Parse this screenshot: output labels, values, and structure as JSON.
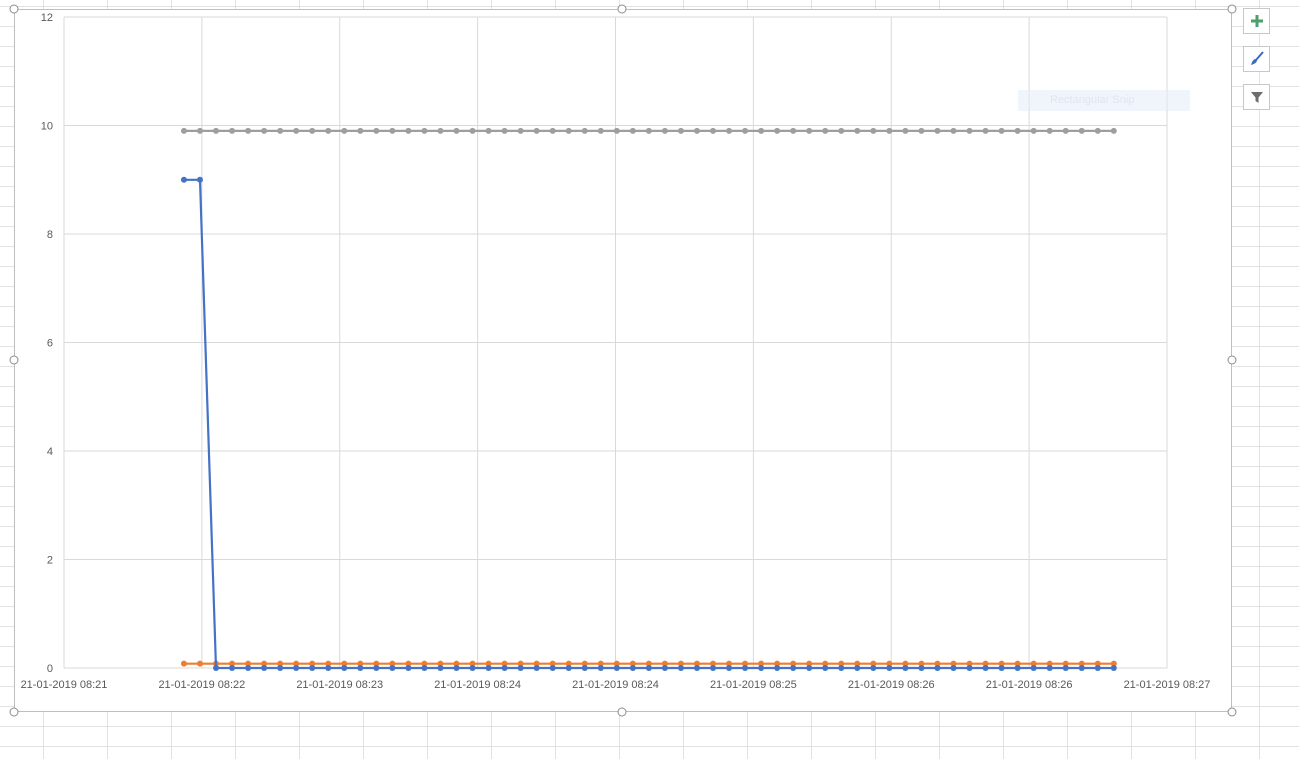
{
  "chart_data": {
    "type": "line",
    "title": "",
    "xlabel": "",
    "ylabel": "",
    "ylim": [
      0,
      12
    ],
    "y_ticks": [
      0,
      2,
      4,
      6,
      8,
      10,
      12
    ],
    "x_tick_labels": [
      "21-01-2019 08:21",
      "21-01-2019 08:22",
      "21-01-2019 08:23",
      "21-01-2019 08:24",
      "21-01-2019 08:24",
      "21-01-2019 08:25",
      "21-01-2019 08:26",
      "21-01-2019 08:26",
      "21-01-2019 08:27"
    ],
    "gridlines": true,
    "legend": "none",
    "point_count": 59,
    "series": [
      {
        "color": "#9e9e9e",
        "values": [
          9.9,
          9.9,
          9.9,
          9.9,
          9.9,
          9.9,
          9.9,
          9.9,
          9.9,
          9.9,
          9.9,
          9.9,
          9.9,
          9.9,
          9.9,
          9.9,
          9.9,
          9.9,
          9.9,
          9.9,
          9.9,
          9.9,
          9.9,
          9.9,
          9.9,
          9.9,
          9.9,
          9.9,
          9.9,
          9.9,
          9.9,
          9.9,
          9.9,
          9.9,
          9.9,
          9.9,
          9.9,
          9.9,
          9.9,
          9.9,
          9.9,
          9.9,
          9.9,
          9.9,
          9.9,
          9.9,
          9.9,
          9.9,
          9.9,
          9.9,
          9.9,
          9.9,
          9.9,
          9.9,
          9.9,
          9.9,
          9.9,
          9.9,
          9.9
        ]
      },
      {
        "color": "#ed7d31",
        "values": [
          0.08,
          0.08,
          0.08,
          0.08,
          0.08,
          0.08,
          0.08,
          0.08,
          0.08,
          0.08,
          0.08,
          0.08,
          0.08,
          0.08,
          0.08,
          0.08,
          0.08,
          0.08,
          0.08,
          0.08,
          0.08,
          0.08,
          0.08,
          0.08,
          0.08,
          0.08,
          0.08,
          0.08,
          0.08,
          0.08,
          0.08,
          0.08,
          0.08,
          0.08,
          0.08,
          0.08,
          0.08,
          0.08,
          0.08,
          0.08,
          0.08,
          0.08,
          0.08,
          0.08,
          0.08,
          0.08,
          0.08,
          0.08,
          0.08,
          0.08,
          0.08,
          0.08,
          0.08,
          0.08,
          0.08,
          0.08,
          0.08,
          0.08,
          0.08
        ]
      },
      {
        "color": "#4472c4",
        "values": [
          9,
          9,
          0,
          0,
          0,
          0,
          0,
          0,
          0,
          0,
          0,
          0,
          0,
          0,
          0,
          0,
          0,
          0,
          0,
          0,
          0,
          0,
          0,
          0,
          0,
          0,
          0,
          0,
          0,
          0,
          0,
          0,
          0,
          0,
          0,
          0,
          0,
          0,
          0,
          0,
          0,
          0,
          0,
          0,
          0,
          0,
          0,
          0,
          0,
          0,
          0,
          0,
          0,
          0,
          0,
          0,
          0,
          0,
          0
        ]
      }
    ]
  },
  "tools": {
    "add_element_icon": "plus-icon",
    "style_icon": "paintbrush-icon",
    "filter_icon": "funnel-icon",
    "add_color": "#4f9e6e",
    "brush_color": "#3b6cc2",
    "filter_color": "#6d6d6d"
  },
  "ghost_tooltip": "Rectangular Snip"
}
